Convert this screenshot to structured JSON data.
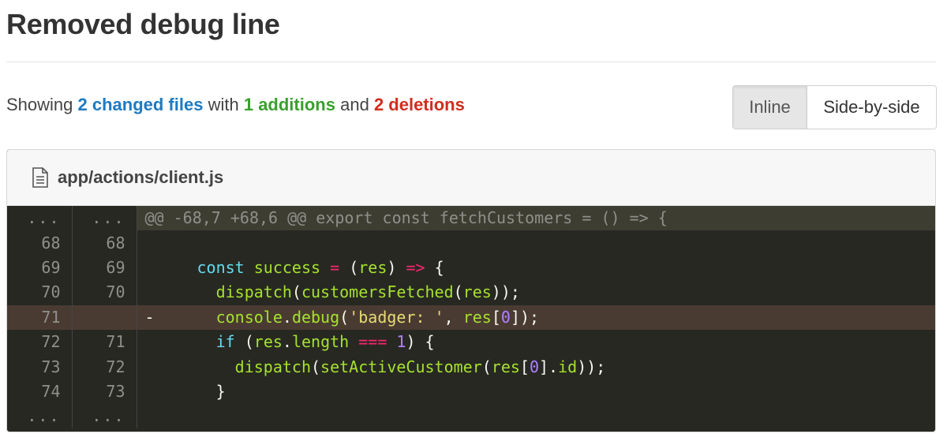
{
  "page": {
    "title": "Removed debug line"
  },
  "summary": {
    "prefix": "Showing",
    "files": "2 changed files",
    "mid1": "with",
    "additions": "1 additions",
    "mid2": "and",
    "deletions": "2 deletions"
  },
  "view_toggle": {
    "inline_label": "Inline",
    "side_by_side_label": "Side-by-side",
    "selected": "Inline"
  },
  "file": {
    "icon": "file-text-icon",
    "path": "app/actions/client.js",
    "hunk_header": "@@ -68,7 +68,6 @@ export const fetchCustomers = () => {",
    "ellipsis": "...",
    "deleted_marker": "-",
    "rows": [
      {
        "old": "68",
        "new": "68"
      },
      {
        "old": "69",
        "new": "69"
      },
      {
        "old": "70",
        "new": "70"
      },
      {
        "old": "71",
        "new": ""
      },
      {
        "old": "72",
        "new": "71"
      },
      {
        "old": "73",
        "new": "72"
      },
      {
        "old": "74",
        "new": "73"
      }
    ]
  },
  "colors": {
    "files_link": "#1f7ac0",
    "additions": "#3aa02e",
    "deletions": "#d12d1f",
    "code_background": "#272822",
    "deleted_row_background": "#4a3b32"
  }
}
